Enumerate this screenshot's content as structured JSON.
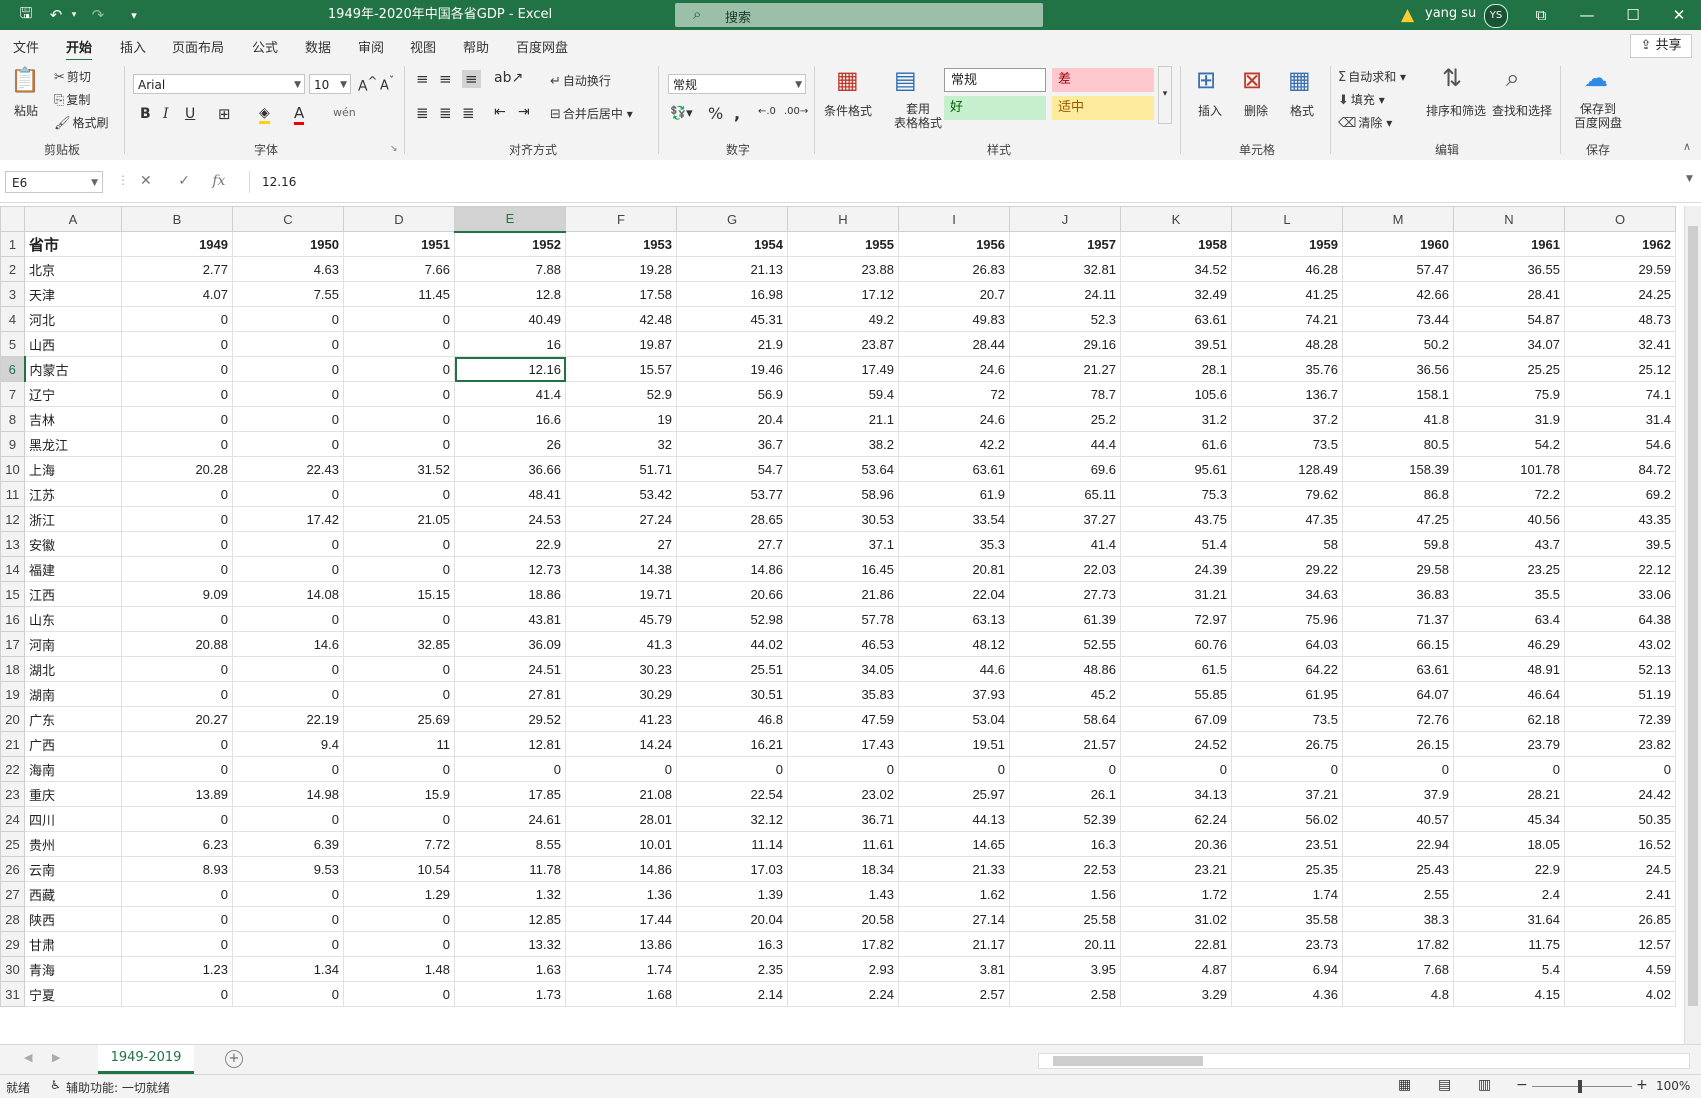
{
  "window": {
    "title": "1949年-2020年中国各省GDP  -  Excel",
    "search_placeholder": "搜索",
    "user": "yang su",
    "avatar_initials": "YS"
  },
  "ribbon_tabs": [
    "文件",
    "开始",
    "插入",
    "页面布局",
    "公式",
    "数据",
    "审阅",
    "视图",
    "帮助",
    "百度网盘"
  ],
  "active_tab": "开始",
  "share_label": "共享",
  "ribbon": {
    "clipboard": {
      "paste": "粘贴",
      "cut": "剪切",
      "copy": "复制",
      "format_painter": "格式刷",
      "group": "剪贴板"
    },
    "font": {
      "name": "Arial",
      "size": "10",
      "group": "字体"
    },
    "alignment": {
      "wrap": "自动换行",
      "merge": "合并后居中",
      "group": "对齐方式"
    },
    "number": {
      "format": "常规",
      "group": "数字"
    },
    "styles": {
      "conditional": "条件格式",
      "table": "套用\n表格格式",
      "normal": "常规",
      "bad": "差",
      "good": "好",
      "neutral": "适中",
      "group": "样式"
    },
    "cells": {
      "insert": "插入",
      "delete": "删除",
      "format": "格式",
      "group": "单元格"
    },
    "editing": {
      "autosum": "自动求和",
      "fill": "填充",
      "clear": "清除",
      "sort": "排序和筛选",
      "find": "查找和选择",
      "group": "编辑"
    },
    "save": {
      "label": "保存到\n百度网盘",
      "group": "保存"
    }
  },
  "formula_bar": {
    "name_box": "E6",
    "value": "12.16"
  },
  "columns": [
    "A",
    "B",
    "C",
    "D",
    "E",
    "F",
    "G",
    "H",
    "I",
    "J",
    "K",
    "L",
    "M",
    "N",
    "O"
  ],
  "header_row": [
    "省市",
    "1949",
    "1950",
    "1951",
    "1952",
    "1953",
    "1954",
    "1955",
    "1956",
    "1957",
    "1958",
    "1959",
    "1960",
    "1961",
    "1962"
  ],
  "rows": [
    [
      "北京",
      "2.77",
      "4.63",
      "7.66",
      "7.88",
      "19.28",
      "21.13",
      "23.88",
      "26.83",
      "32.81",
      "34.52",
      "46.28",
      "57.47",
      "36.55",
      "29.59"
    ],
    [
      "天津",
      "4.07",
      "7.55",
      "11.45",
      "12.8",
      "17.58",
      "16.98",
      "17.12",
      "20.7",
      "24.11",
      "32.49",
      "41.25",
      "42.66",
      "28.41",
      "24.25"
    ],
    [
      "河北",
      "0",
      "0",
      "0",
      "40.49",
      "42.48",
      "45.31",
      "49.2",
      "49.83",
      "52.3",
      "63.61",
      "74.21",
      "73.44",
      "54.87",
      "48.73"
    ],
    [
      "山西",
      "0",
      "0",
      "0",
      "16",
      "19.87",
      "21.9",
      "23.87",
      "28.44",
      "29.16",
      "39.51",
      "48.28",
      "50.2",
      "34.07",
      "32.41"
    ],
    [
      "内蒙古",
      "0",
      "0",
      "0",
      "12.16",
      "15.57",
      "19.46",
      "17.49",
      "24.6",
      "21.27",
      "28.1",
      "35.76",
      "36.56",
      "25.25",
      "25.12"
    ],
    [
      "辽宁",
      "0",
      "0",
      "0",
      "41.4",
      "52.9",
      "56.9",
      "59.4",
      "72",
      "78.7",
      "105.6",
      "136.7",
      "158.1",
      "75.9",
      "74.1"
    ],
    [
      "吉林",
      "0",
      "0",
      "0",
      "16.6",
      "19",
      "20.4",
      "21.1",
      "24.6",
      "25.2",
      "31.2",
      "37.2",
      "41.8",
      "31.9",
      "31.4"
    ],
    [
      "黑龙江",
      "0",
      "0",
      "0",
      "26",
      "32",
      "36.7",
      "38.2",
      "42.2",
      "44.4",
      "61.6",
      "73.5",
      "80.5",
      "54.2",
      "54.6"
    ],
    [
      "上海",
      "20.28",
      "22.43",
      "31.52",
      "36.66",
      "51.71",
      "54.7",
      "53.64",
      "63.61",
      "69.6",
      "95.61",
      "128.49",
      "158.39",
      "101.78",
      "84.72"
    ],
    [
      "江苏",
      "0",
      "0",
      "0",
      "48.41",
      "53.42",
      "53.77",
      "58.96",
      "61.9",
      "65.11",
      "75.3",
      "79.62",
      "86.8",
      "72.2",
      "69.2"
    ],
    [
      "浙江",
      "0",
      "17.42",
      "21.05",
      "24.53",
      "27.24",
      "28.65",
      "30.53",
      "33.54",
      "37.27",
      "43.75",
      "47.35",
      "47.25",
      "40.56",
      "43.35"
    ],
    [
      "安徽",
      "0",
      "0",
      "0",
      "22.9",
      "27",
      "27.7",
      "37.1",
      "35.3",
      "41.4",
      "51.4",
      "58",
      "59.8",
      "43.7",
      "39.5"
    ],
    [
      "福建",
      "0",
      "0",
      "0",
      "12.73",
      "14.38",
      "14.86",
      "16.45",
      "20.81",
      "22.03",
      "24.39",
      "29.22",
      "29.58",
      "23.25",
      "22.12"
    ],
    [
      "江西",
      "9.09",
      "14.08",
      "15.15",
      "18.86",
      "19.71",
      "20.66",
      "21.86",
      "22.04",
      "27.73",
      "31.21",
      "34.63",
      "36.83",
      "35.5",
      "33.06"
    ],
    [
      "山东",
      "0",
      "0",
      "0",
      "43.81",
      "45.79",
      "52.98",
      "57.78",
      "63.13",
      "61.39",
      "72.97",
      "75.96",
      "71.37",
      "63.4",
      "64.38"
    ],
    [
      "河南",
      "20.88",
      "14.6",
      "32.85",
      "36.09",
      "41.3",
      "44.02",
      "46.53",
      "48.12",
      "52.55",
      "60.76",
      "64.03",
      "66.15",
      "46.29",
      "43.02"
    ],
    [
      "湖北",
      "0",
      "0",
      "0",
      "24.51",
      "30.23",
      "25.51",
      "34.05",
      "44.6",
      "48.86",
      "61.5",
      "64.22",
      "63.61",
      "48.91",
      "52.13"
    ],
    [
      "湖南",
      "0",
      "0",
      "0",
      "27.81",
      "30.29",
      "30.51",
      "35.83",
      "37.93",
      "45.2",
      "55.85",
      "61.95",
      "64.07",
      "46.64",
      "51.19"
    ],
    [
      "广东",
      "20.27",
      "22.19",
      "25.69",
      "29.52",
      "41.23",
      "46.8",
      "47.59",
      "53.04",
      "58.64",
      "67.09",
      "73.5",
      "72.76",
      "62.18",
      "72.39"
    ],
    [
      "广西",
      "0",
      "9.4",
      "11",
      "12.81",
      "14.24",
      "16.21",
      "17.43",
      "19.51",
      "21.57",
      "24.52",
      "26.75",
      "26.15",
      "23.79",
      "23.82"
    ],
    [
      "海南",
      "0",
      "0",
      "0",
      "0",
      "0",
      "0",
      "0",
      "0",
      "0",
      "0",
      "0",
      "0",
      "0",
      "0"
    ],
    [
      "重庆",
      "13.89",
      "14.98",
      "15.9",
      "17.85",
      "21.08",
      "22.54",
      "23.02",
      "25.97",
      "26.1",
      "34.13",
      "37.21",
      "37.9",
      "28.21",
      "24.42"
    ],
    [
      "四川",
      "0",
      "0",
      "0",
      "24.61",
      "28.01",
      "32.12",
      "36.71",
      "44.13",
      "52.39",
      "62.24",
      "56.02",
      "40.57",
      "45.34",
      "50.35"
    ],
    [
      "贵州",
      "6.23",
      "6.39",
      "7.72",
      "8.55",
      "10.01",
      "11.14",
      "11.61",
      "14.65",
      "16.3",
      "20.36",
      "23.51",
      "22.94",
      "18.05",
      "16.52"
    ],
    [
      "云南",
      "8.93",
      "9.53",
      "10.54",
      "11.78",
      "14.86",
      "17.03",
      "18.34",
      "21.33",
      "22.53",
      "23.21",
      "25.35",
      "25.43",
      "22.9",
      "24.5"
    ],
    [
      "西藏",
      "0",
      "0",
      "1.29",
      "1.32",
      "1.36",
      "1.39",
      "1.43",
      "1.62",
      "1.56",
      "1.72",
      "1.74",
      "2.55",
      "2.4",
      "2.41"
    ],
    [
      "陕西",
      "0",
      "0",
      "0",
      "12.85",
      "17.44",
      "20.04",
      "20.58",
      "27.14",
      "25.58",
      "31.02",
      "35.58",
      "38.3",
      "31.64",
      "26.85"
    ],
    [
      "甘肃",
      "0",
      "0",
      "0",
      "13.32",
      "13.86",
      "16.3",
      "17.82",
      "21.17",
      "20.11",
      "22.81",
      "23.73",
      "17.82",
      "11.75",
      "12.57"
    ],
    [
      "青海",
      "1.23",
      "1.34",
      "1.48",
      "1.63",
      "1.74",
      "2.35",
      "2.93",
      "3.81",
      "3.95",
      "4.87",
      "6.94",
      "7.68",
      "5.4",
      "4.59"
    ],
    [
      "宁夏",
      "0",
      "0",
      "0",
      "1.73",
      "1.68",
      "2.14",
      "2.24",
      "2.57",
      "2.58",
      "3.29",
      "4.36",
      "4.8",
      "4.15",
      "4.02"
    ]
  ],
  "sheet_tab": "1949-2019",
  "status": {
    "ready": "就绪",
    "accessibility": "辅助功能: 一切就绪",
    "zoom": "100%"
  }
}
